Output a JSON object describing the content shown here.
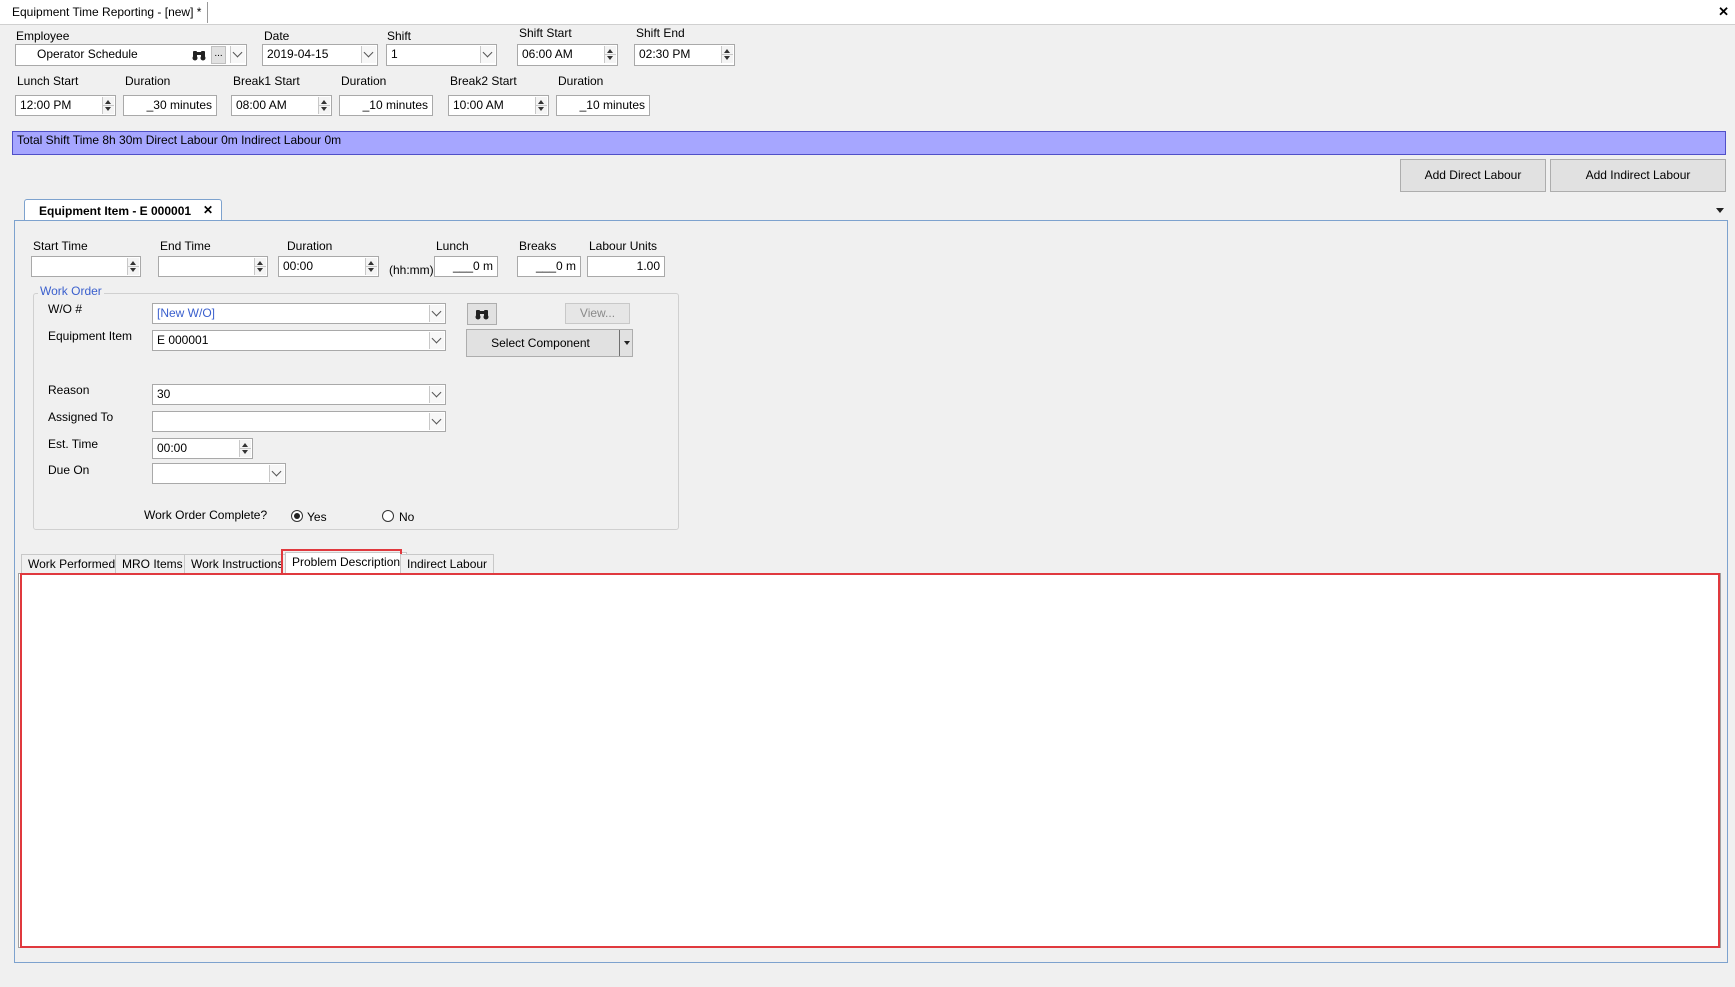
{
  "window": {
    "title": "Equipment Time Reporting - [new] *",
    "close_glyph": "✕"
  },
  "header": {
    "employee": {
      "label": "Employee",
      "value": "Operator Schedule",
      "browse_glyph": "..."
    },
    "date": {
      "label": "Date",
      "value": "2019-04-15"
    },
    "shift": {
      "label": "Shift",
      "value": "1"
    },
    "shift_start": {
      "label": "Shift Start",
      "value": "06:00 AM"
    },
    "shift_end": {
      "label": "Shift End",
      "value": "02:30 PM"
    },
    "lunch_start": {
      "label": "Lunch Start",
      "value": "12:00 PM"
    },
    "lunch_duration": {
      "label": "Duration",
      "value": "_30 minutes"
    },
    "break1_start": {
      "label": "Break1 Start",
      "value": "08:00 AM"
    },
    "break1_duration": {
      "label": "Duration",
      "value": "_10 minutes"
    },
    "break2_start": {
      "label": "Break2 Start",
      "value": "10:00 AM"
    },
    "break2_duration": {
      "label": "Duration",
      "value": "_10 minutes"
    }
  },
  "summary": {
    "text": "Total Shift Time 8h 30m  Direct Labour 0m  Indirect Labour 0m",
    "color": "#a6a6ff"
  },
  "actions": {
    "add_direct": "Add Direct Labour",
    "add_indirect": "Add Indirect Labour"
  },
  "doc_tab": {
    "title": "Equipment Item - E 000001",
    "close_glyph": "✕"
  },
  "time_row": {
    "start_time": {
      "label": "Start Time",
      "value": ""
    },
    "end_time": {
      "label": "End Time",
      "value": ""
    },
    "duration": {
      "label": "Duration",
      "value": "00:00",
      "hint": "(hh:mm)"
    },
    "lunch": {
      "label": "Lunch",
      "value": "___0 m"
    },
    "breaks": {
      "label": "Breaks",
      "value": "___0 m"
    },
    "labour_units": {
      "label": "Labour Units",
      "value": "1.00"
    }
  },
  "work_order": {
    "group_label": "Work Order",
    "wo_number": {
      "label": "W/O #",
      "value": "[New W/O]"
    },
    "view_button": "View...",
    "equipment_item": {
      "label": "Equipment Item",
      "value": "E 000001"
    },
    "select_component": "Select Component",
    "reason": {
      "label": "Reason",
      "value": "30"
    },
    "assigned_to": {
      "label": "Assigned To",
      "value": ""
    },
    "est_time": {
      "label": "Est. Time",
      "value": "00:00"
    },
    "due_on": {
      "label": "Due On",
      "value": ""
    },
    "complete": {
      "label": "Work Order Complete?",
      "yes": "Yes",
      "no": "No",
      "selected": "Yes"
    }
  },
  "tabs": [
    {
      "label": "Work Performed"
    },
    {
      "label": "MRO Items"
    },
    {
      "label": "Work Instructions"
    },
    {
      "label": "Problem Description",
      "active": true
    },
    {
      "label": "Indirect Labour"
    }
  ],
  "colors": {
    "highlight": "#e0393e",
    "link_blue": "#3a5fcd"
  }
}
